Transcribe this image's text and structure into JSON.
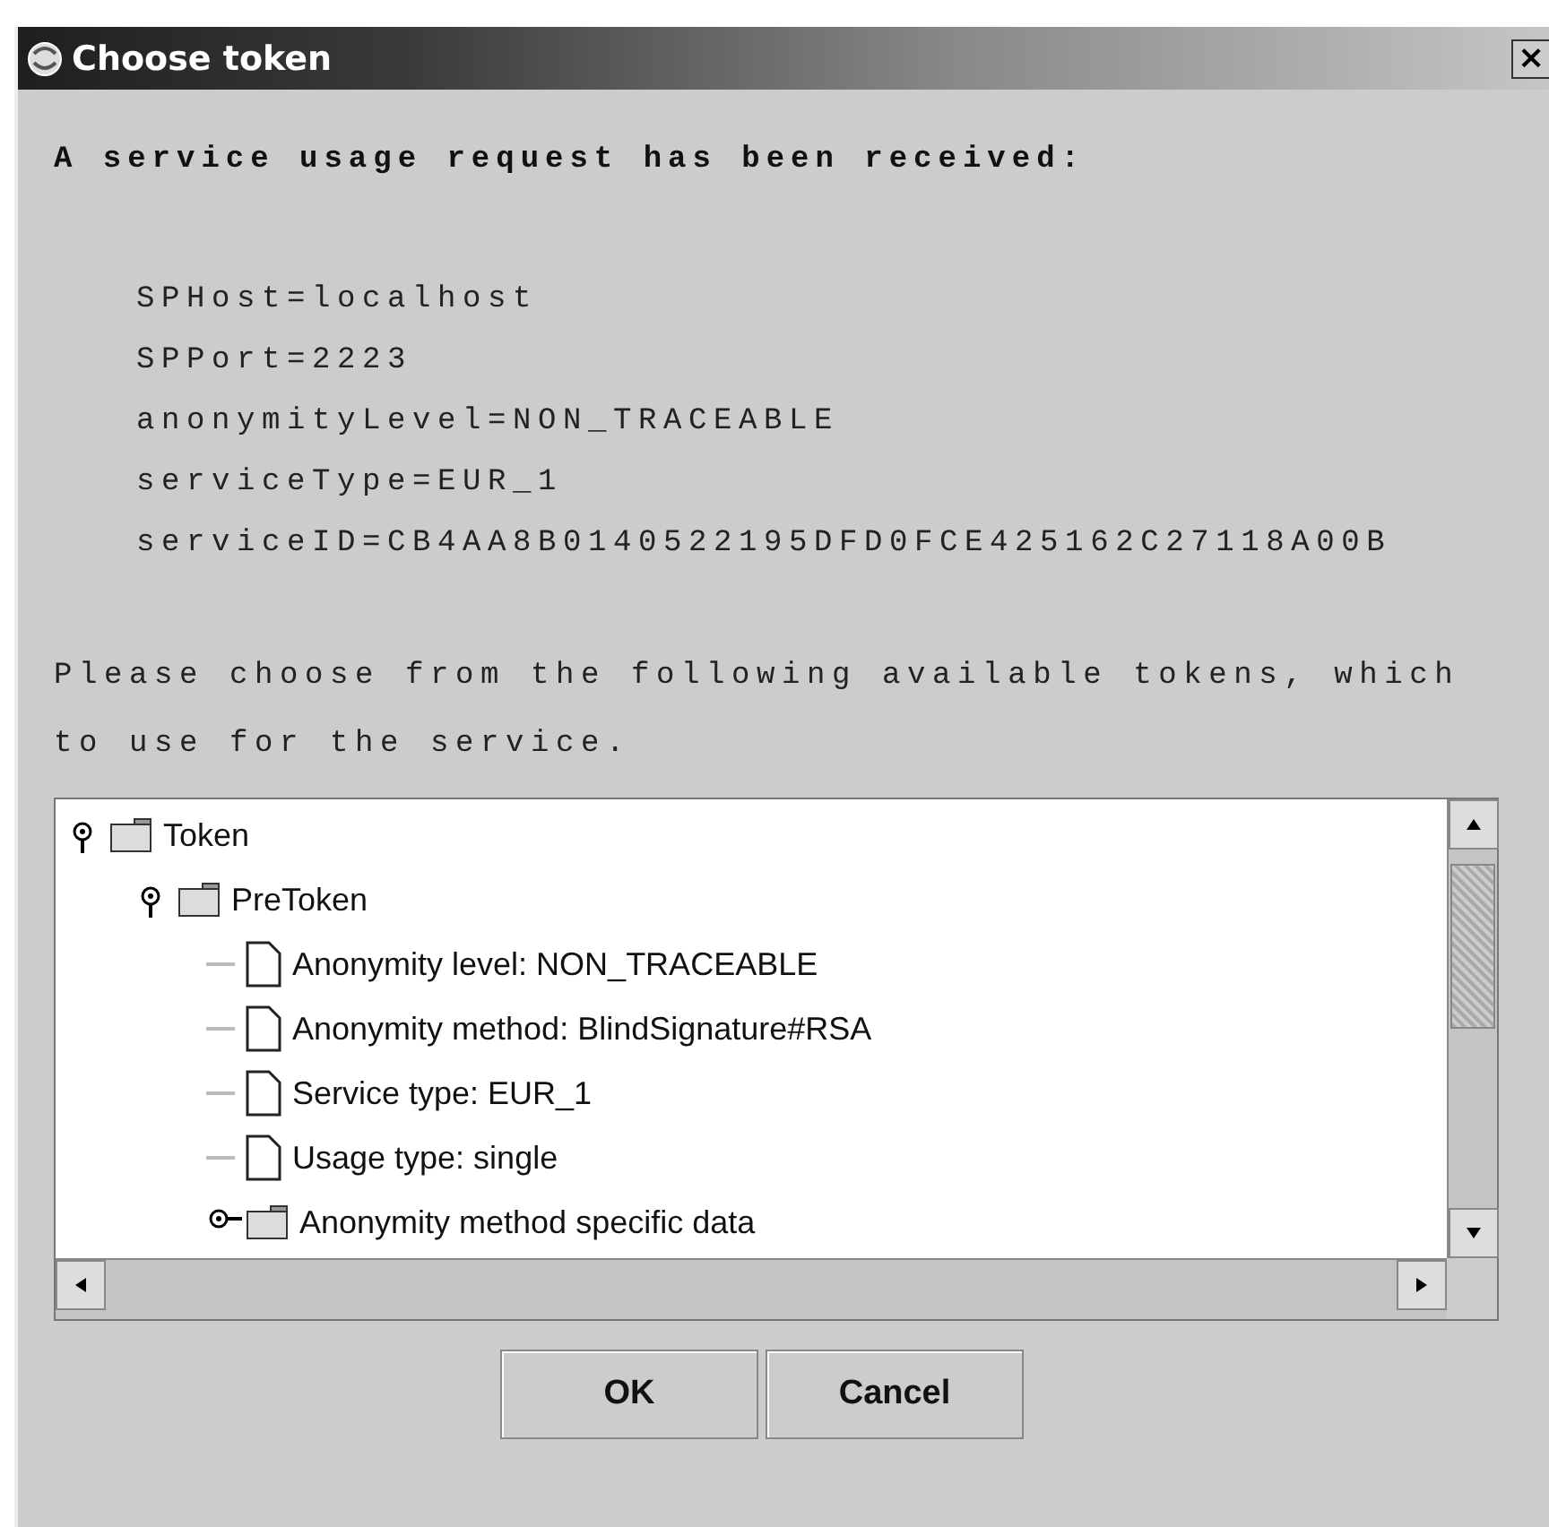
{
  "window": {
    "title": "Choose token",
    "close_button": "×"
  },
  "heading": "A service usage request has been received:",
  "request_lines": [
    "SPHost=localhost",
    "SPPort=2223",
    "anonymityLevel=NON_TRACEABLE",
    "serviceType=EUR_1",
    "serviceID=CB4AA8B0140522195DFD0FCE425162C27118A00B"
  ],
  "instruction": "Please choose from the following available tokens, which to use for the service.",
  "tree": [
    {
      "label": "Token",
      "kind": "folder",
      "expanded": true,
      "children": [
        {
          "label": "PreToken",
          "kind": "folder",
          "expanded": true,
          "children": [
            {
              "label": "Anonymity level: NON_TRACEABLE",
              "kind": "leaf"
            },
            {
              "label": "Anonymity method: BlindSignature#RSA",
              "kind": "leaf"
            },
            {
              "label": "Service type: EUR_1",
              "kind": "leaf"
            },
            {
              "label": "Usage type: single",
              "kind": "leaf"
            },
            {
              "label": "Anonymity method specific data",
              "kind": "folder",
              "expanded": false
            }
          ]
        }
      ]
    }
  ],
  "buttons": [
    "OK",
    "Cancel"
  ]
}
